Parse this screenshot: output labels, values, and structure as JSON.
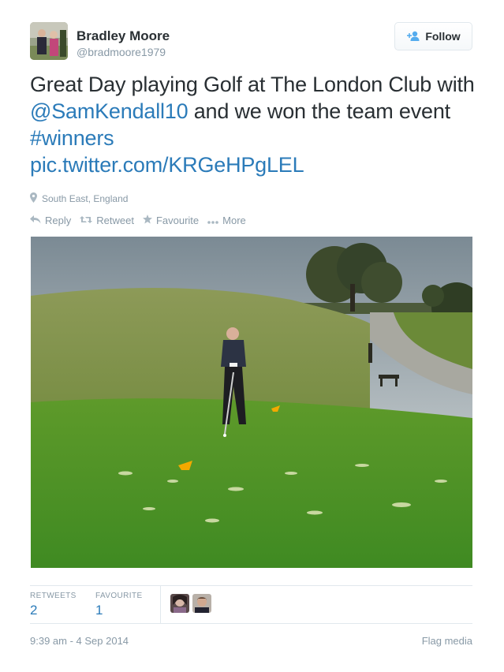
{
  "header": {
    "display_name": "Bradley Moore",
    "handle": "@bradmoore1979",
    "follow_label": "Follow",
    "avatar_icon": "profile-photo",
    "follow_icon": "add-user-icon"
  },
  "tweet": {
    "text_part1": "Great Day playing Golf at The London Club with ",
    "mention": "@SamKendall10",
    "text_part2": " and we won the team event ",
    "hashtag": "#winners",
    "pic_link": "pic.twitter.com/KRGeHPgLEL"
  },
  "location": {
    "icon": "map-pin-icon",
    "label": "South East, England"
  },
  "actions": {
    "reply": "Reply",
    "retweet": "Retweet",
    "favourite": "Favourite",
    "more": "More"
  },
  "stats": {
    "retweets_label": "RETWEETS",
    "retweets_count": "2",
    "favourites_label": "FAVOURITE",
    "favourites_count": "1"
  },
  "footer": {
    "timestamp": "9:39 am - 4 Sep 2014",
    "flag": "Flag media"
  },
  "colors": {
    "link": "#2b7bb9",
    "muted": "#8899a6",
    "text": "#292f33"
  }
}
